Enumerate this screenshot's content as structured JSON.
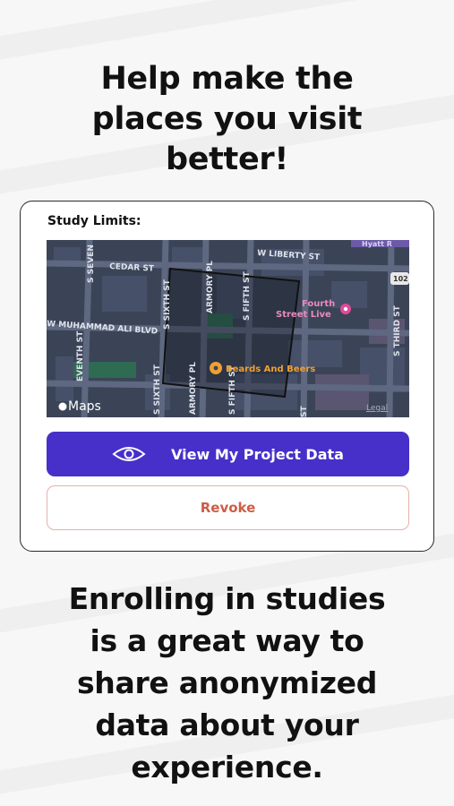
{
  "headline": {
    "lines": [
      "Help make the",
      "places you visit",
      "better!"
    ]
  },
  "card": {
    "label": "Study Limits:",
    "map": {
      "streets": {
        "w_liberty": "W LIBERTY ST",
        "cedar": "CEDAR ST",
        "w_muhammad_ali": "W MUHAMMAD ALI BLVD",
        "s_seventh_top": "S SEVEN",
        "seventh_left": "EVENTH ST",
        "s_sixth_top": "S SIXTH ST",
        "s_sixth_bottom": "S SIXTH ST",
        "armory_top": "ARMORY PL",
        "armory_bottom": "ARMORY PL",
        "s_fifth_top": "S FIFTH ST",
        "s_fifth_bottom": "S FIFTH ST",
        "s_third": "S THIRD ST",
        "st_bottom": "ST",
        "hyatt": "Hyatt R"
      },
      "pois": {
        "fourth_street_line1": "Fourth",
        "fourth_street_line2": "Street Live",
        "beards_and_beers": "Beards And Beers"
      },
      "route_badge": "102",
      "attribution": "Maps",
      "legal": "Legal"
    },
    "primary_button": {
      "label": "View My Project Data",
      "icon": "eye-icon"
    },
    "secondary_button": {
      "label": "Revoke"
    }
  },
  "body_text": {
    "lines": [
      "Enrolling in studies",
      "is a great way to",
      "share anonymized",
      "data about your",
      "experience."
    ]
  },
  "colors": {
    "primary": "#4630c9",
    "revoke_text": "#cf5d45",
    "revoke_border": "#e3b3a7",
    "map_bg": "#3a4356",
    "poi_pink": "#e04a9a",
    "poi_orange": "#f0a030"
  }
}
